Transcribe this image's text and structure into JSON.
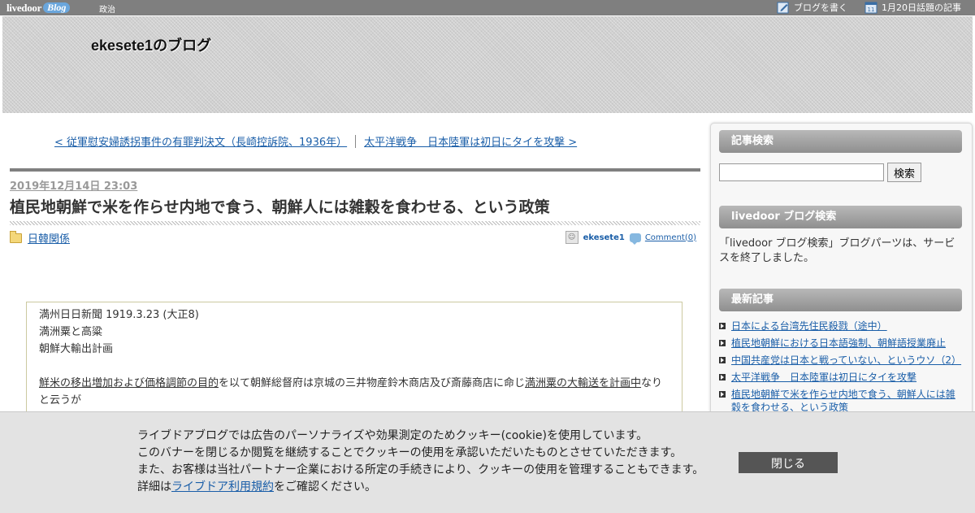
{
  "topbar": {
    "logo_main": "livedoor",
    "logo_blog": "Blog",
    "category": "政治",
    "write_label": "ブログを書く",
    "topic_label": "1月20日話題の記事"
  },
  "header": {
    "blog_title": "ekesete1のブログ"
  },
  "post": {
    "prev_link": "< 従軍慰安婦誘拐事件の有罪判決文（長崎控訴院、1936年）",
    "next_link": "太平洋戦争　日本陸軍は初日にタイを攻撃 >",
    "date": "2019年12月14日 23:03",
    "title": "植民地朝鮮で米を作らせ内地で食う、朝鮮人には雑穀を食わせる、という政策",
    "category": "日韓関係",
    "author": "ekesete1",
    "comments": "Comment(0)",
    "body": {
      "line1": "満州日日新聞 1919.3.23 (大正8)",
      "line2": "満洲粟と高粱",
      "line3": "朝鮮大輸出計画",
      "para_u1": "鮮米の移出増加および価格調節の目的",
      "para_t1": "を以て朝鮮総督府は京城の三井物産鈴木商店及び斎藤商店に命じ",
      "para_u2": "満洲粟の大輸送を計画中",
      "para_t2": "なり",
      "para_t3": "と云うが"
    }
  },
  "sidebar": {
    "search_heading": "記事検索",
    "search_button": "検索",
    "search_value": "",
    "ld_search_heading": "livedoor ブログ検索",
    "ld_search_text": "「livedoor ブログ検索」ブログパーツは、サービスを終了しました。",
    "recent_heading": "最新記事",
    "recent": [
      "日本による台湾先住民殺戮（途中）",
      "植民地朝鮮における日本語強制、朝鮮語授業廃止",
      "中国共産党は日本と戦っていない、というウソ（2）",
      "太平洋戦争　日本陸軍は初日にタイを攻撃",
      "植民地朝鮮で米を作らせ内地で食う、朝鮮人には雑穀を食わせる、という政策"
    ]
  },
  "cookie": {
    "line1": "ライブドアブログでは広告のパーソナライズや効果測定のためクッキー(cookie)を使用しています。",
    "line2": "このバナーを閉じるか閲覧を継続することでクッキーの使用を承認いただいたものとさせていただきます。",
    "line3": "また、お客様は当社パートナー企業における所定の手続きにより、クッキーの使用を管理することもできます。",
    "line4_pre": "詳細は",
    "line4_link": "ライブドア利用規約",
    "line4_post": "をご確認ください。",
    "close_label": "閉じる"
  }
}
